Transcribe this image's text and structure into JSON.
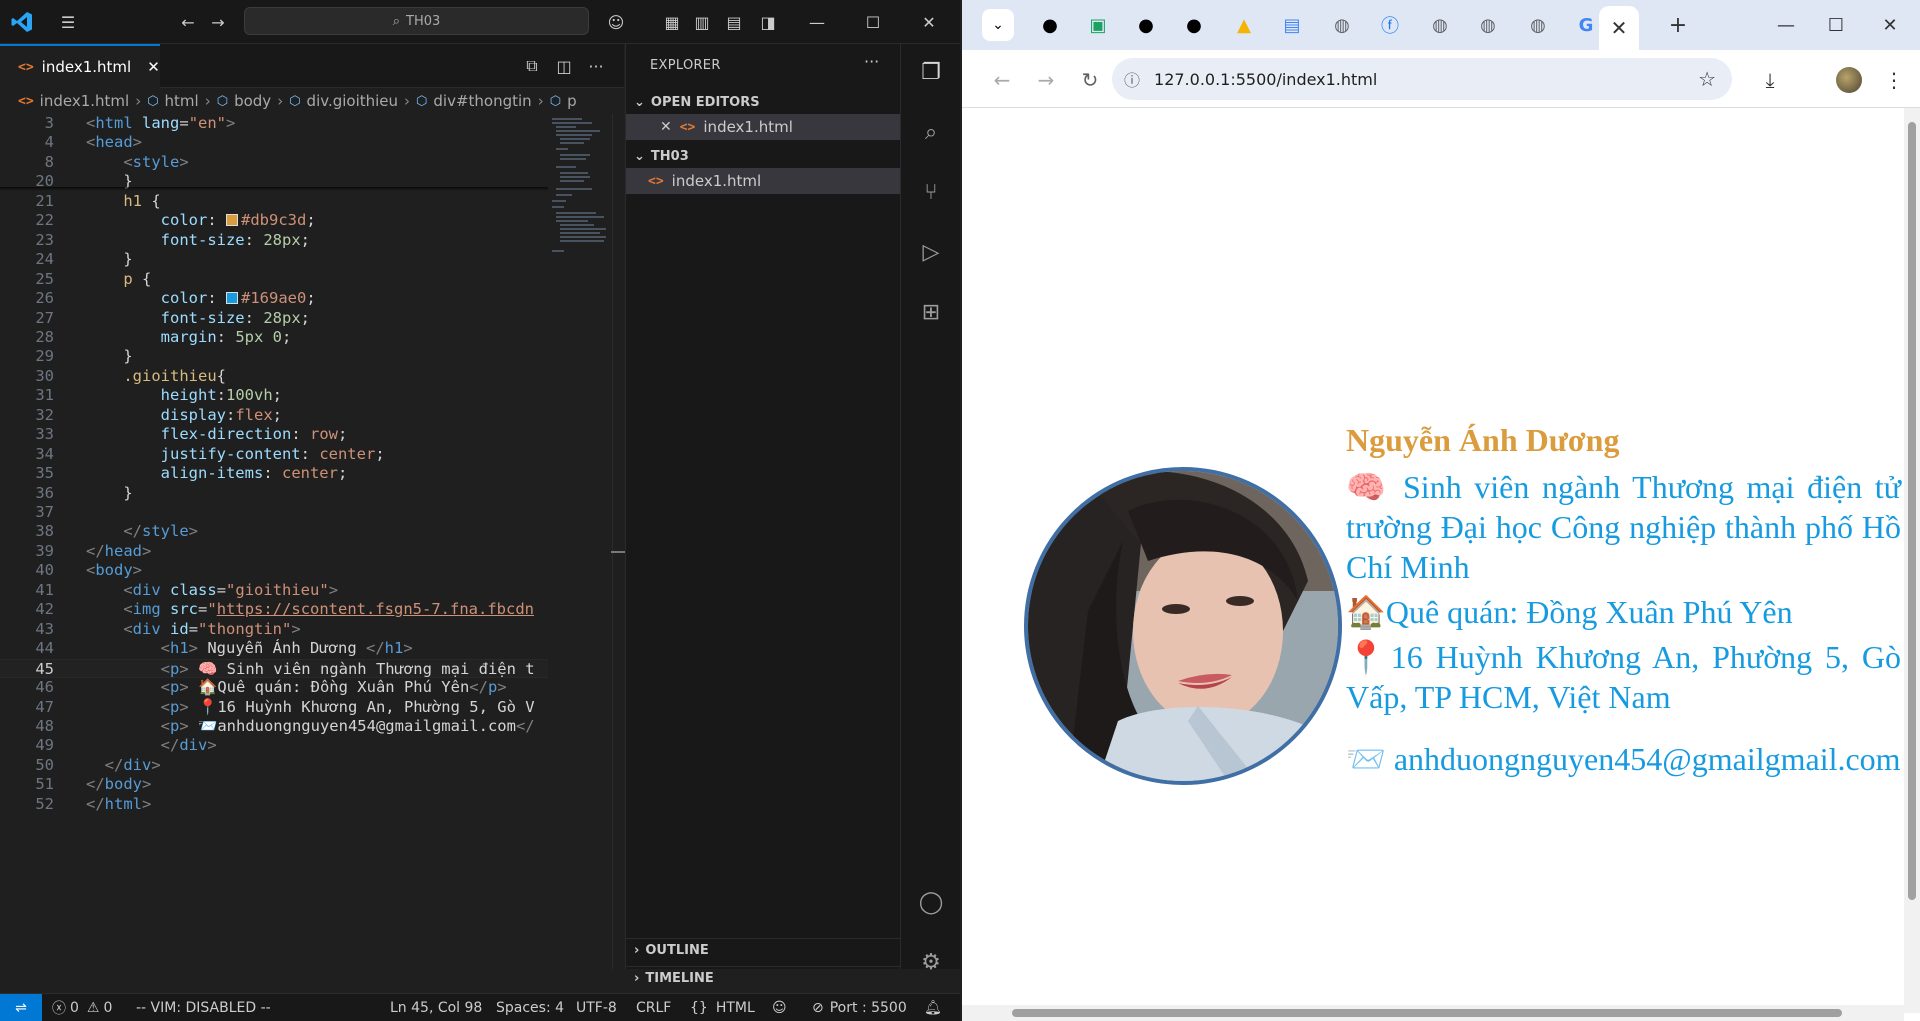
{
  "vscode": {
    "search_text": "TH03",
    "tab_label": "index1.html",
    "breadcrumb": [
      "index1.html",
      "html",
      "body",
      "div.gioithieu",
      "div#thongtin",
      "p"
    ],
    "code_lines": [
      {
        "n": "3",
        "html": "<span class='t-br'>&lt;</span><span class='t-tag'>html</span> <span class='t-attr'>lang</span>=<span class='t-str'>\"en\"</span><span class='t-br'>&gt;</span>"
      },
      {
        "n": "4",
        "html": "<span class='t-br'>&lt;</span><span class='t-tag'>head</span><span class='t-br'>&gt;</span>"
      },
      {
        "n": "8",
        "html": "    <span class='t-br'>&lt;</span><span class='t-tag'>style</span><span class='t-br'>&gt;</span>"
      },
      {
        "n": "20",
        "html": "    <span class='t-txt'>}</span>"
      },
      {
        "n": "21",
        "html": "    <span class='t-sel'>h1</span> <span class='t-txt'>{</span>"
      },
      {
        "n": "22",
        "html": "        <span class='t-prop'>color</span><span class='t-txt'>: </span><span class='swatch' style='background:#db9c3d'></span><span class='t-val'>#db9c3d</span><span class='t-txt'>;</span>"
      },
      {
        "n": "23",
        "html": "        <span class='t-prop'>font-size</span><span class='t-txt'>: </span><span class='t-num'>28px</span><span class='t-txt'>;</span>"
      },
      {
        "n": "24",
        "html": "    <span class='t-txt'>}</span>"
      },
      {
        "n": "25",
        "html": "    <span class='t-sel'>p</span> <span class='t-txt'>{</span>"
      },
      {
        "n": "26",
        "html": "        <span class='t-prop'>color</span><span class='t-txt'>: </span><span class='swatch' style='background:#169ae0'></span><span class='t-val'>#169ae0</span><span class='t-txt'>;</span>"
      },
      {
        "n": "27",
        "html": "        <span class='t-prop'>font-size</span><span class='t-txt'>: </span><span class='t-num'>28px</span><span class='t-txt'>;</span>"
      },
      {
        "n": "28",
        "html": "        <span class='t-prop'>margin</span><span class='t-txt'>: </span><span class='t-num'>5px 0</span><span class='t-txt'>;</span>"
      },
      {
        "n": "29",
        "html": "    <span class='t-txt'>}</span>"
      },
      {
        "n": "30",
        "html": "    <span class='t-sel'>.gioithieu</span><span class='t-txt'>{</span>"
      },
      {
        "n": "31",
        "html": "        <span class='t-prop'>height</span><span class='t-txt'>:</span><span class='t-num'>100vh</span><span class='t-txt'>;</span>"
      },
      {
        "n": "32",
        "html": "        <span class='t-prop'>display</span><span class='t-txt'>:</span><span class='t-val'>flex</span><span class='t-txt'>;</span>"
      },
      {
        "n": "33",
        "html": "        <span class='t-prop'>flex-direction</span><span class='t-txt'>: </span><span class='t-val'>row</span><span class='t-txt'>;</span>"
      },
      {
        "n": "34",
        "html": "        <span class='t-prop'>justify-content</span><span class='t-txt'>: </span><span class='t-val'>center</span><span class='t-txt'>;</span>"
      },
      {
        "n": "35",
        "html": "        <span class='t-prop'>align-items</span><span class='t-txt'>: </span><span class='t-val'>center</span><span class='t-txt'>;</span>"
      },
      {
        "n": "36",
        "html": "    <span class='t-txt'>}</span>"
      },
      {
        "n": "37",
        "html": ""
      },
      {
        "n": "38",
        "html": "    <span class='t-br'>&lt;/</span><span class='t-tag'>style</span><span class='t-br'>&gt;</span>"
      },
      {
        "n": "39",
        "html": "<span class='t-br'>&lt;/</span><span class='t-tag'>head</span><span class='t-br'>&gt;</span>"
      },
      {
        "n": "40",
        "html": "<span class='t-br'>&lt;</span><span class='t-tag'>body</span><span class='t-br'>&gt;</span>"
      },
      {
        "n": "41",
        "html": "    <span class='t-br'>&lt;</span><span class='t-tag'>div</span> <span class='t-attr'>class</span>=<span class='t-str'>\"gioithieu\"</span><span class='t-br'>&gt;</span>"
      },
      {
        "n": "42",
        "html": "    <span class='t-br'>&lt;</span><span class='t-tag'>img</span> <span class='t-attr'>src</span>=<span class='t-str'>\"</span><span class='t-link'>https://scontent.fsgn5-7.fna.fbcdn</span>"
      },
      {
        "n": "43",
        "html": "    <span class='t-br'>&lt;</span><span class='t-tag'>div</span> <span class='t-attr'>id</span>=<span class='t-str'>\"thongtin\"</span><span class='t-br'>&gt;</span>"
      },
      {
        "n": "44",
        "html": "        <span class='t-br'>&lt;</span><span class='t-tag'>h1</span><span class='t-br'>&gt;</span><span class='t-txt'> Nguyễn Ánh Dương </span><span class='t-br'>&lt;/</span><span class='t-tag'>h1</span><span class='t-br'>&gt;</span>"
      },
      {
        "n": "45",
        "html": "        <span class='t-br'>&lt;</span><span class='t-tag'>p</span><span class='t-br'>&gt;</span><span class='t-txt'> 🧠 Sinh viên ngành Thương mại điện t</span>"
      },
      {
        "n": "46",
        "html": "        <span class='t-br'>&lt;</span><span class='t-tag'>p</span><span class='t-br'>&gt;</span><span class='t-txt'> 🏠Quê quán: Đồng Xuân Phú Yên</span><span class='t-br'>&lt;/</span><span class='t-tag'>p</span><span class='t-br'>&gt;</span>"
      },
      {
        "n": "47",
        "html": "        <span class='t-br'>&lt;</span><span class='t-tag'>p</span><span class='t-br'>&gt;</span><span class='t-txt'> 📍16 Huỳnh Khương An, Phường 5, Gò V</span>"
      },
      {
        "n": "48",
        "html": "        <span class='t-br'>&lt;</span><span class='t-tag'>p</span><span class='t-br'>&gt;</span><span class='t-txt'> 📨anhduongnguyen454@gmailgmail.com</span><span class='t-br'>&lt;/</span>"
      },
      {
        "n": "49",
        "html": "        <span class='t-br'>&lt;/</span><span class='t-tag'>div</span><span class='t-br'>&gt;</span>"
      },
      {
        "n": "50",
        "html": "  <span class='t-br'>&lt;/</span><span class='t-tag'>div</span><span class='t-br'>&gt;</span>"
      },
      {
        "n": "51",
        "html": "<span class='t-br'>&lt;/</span><span class='t-tag'>body</span><span class='t-br'>&gt;</span>"
      },
      {
        "n": "52",
        "html": "<span class='t-br'>&lt;/</span><span class='t-tag'>html</span><span class='t-br'>&gt;</span>"
      }
    ],
    "current_line": "45",
    "explorer": {
      "title": "EXPLORER",
      "open_editors_label": "OPEN EDITORS",
      "open_file": "index1.html",
      "folder_label": "TH03",
      "folder_file": "index1.html",
      "outline_label": "OUTLINE",
      "timeline_label": "TIMELINE"
    },
    "status": {
      "errors": "0",
      "warnings": "0",
      "vim": "-- VIM: DISABLED --",
      "position": "Ln 45, Col 98",
      "spaces": "Spaces: 4",
      "encoding": "UTF-8",
      "eol": "CRLF",
      "language": "HTML",
      "port": "Port : 5500"
    }
  },
  "chrome": {
    "url": "127.0.0.1:5500/index1.html",
    "page": {
      "name": "Nguyễn Ánh Dương",
      "paragraphs": [
        "🧠 Sinh viên ngành Thương mại điện tử trường Đại học Công nghiệp thành phố Hồ Chí Minh",
        "🏠Quê quán: Đồng Xuân Phú Yên",
        "📍16 Huỳnh Khương An, Phường 5, Gò Vấp, TP HCM, Việt Nam",
        "📨 anhduongnguyen454@gmailgmail.com"
      ],
      "name_color": "#db9c3d",
      "text_color": "#169ae0"
    }
  }
}
